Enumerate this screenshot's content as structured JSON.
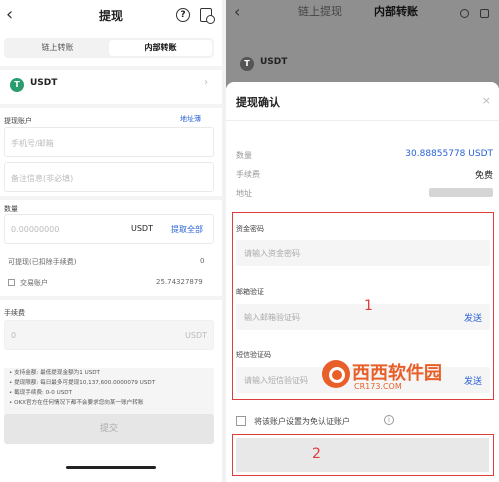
{
  "left": {
    "title": "提现",
    "help_glyph": "?",
    "tabs": [
      {
        "label": "链上转账"
      },
      {
        "label": "内部转账"
      }
    ],
    "coin": {
      "name": "USDT",
      "badge": "T"
    },
    "account": {
      "label": "提现账户",
      "link": "地址薄",
      "phone_placeholder": "手机号/邮箱",
      "remark_placeholder": "备注信息(非必填)"
    },
    "amount": {
      "label": "数量",
      "value": "0.00000000",
      "unit": "USDT",
      "max_link": "提取全部",
      "available_label": "可提现(已扣除手续费)",
      "available_value": "0",
      "trade_account_label": "交易账户",
      "trade_account_value": "25.74327879"
    },
    "fee": {
      "label": "手续费",
      "value": "0",
      "unit": "USDT"
    },
    "notes": [
      "• 支持金额: 最低提现金额为1 USDT",
      "• 提现限额: 每日最多可提现10,137,600.0000079 USDT",
      "• 截现手续费: 0-0 USDT",
      "• OKX官方在任何情况下都不会要求您向某一账户转账"
    ],
    "submit_label": "提交"
  },
  "right": {
    "bg_tabs": [
      "链上提现",
      "内部转账"
    ],
    "coin": {
      "name": "USDT",
      "badge": "T"
    },
    "sheet": {
      "title": "提现确认",
      "close_glyph": "×",
      "amount_key": "数量",
      "amount_value": "30.88855778 USDT",
      "fee_key": "手续费",
      "fee_value": "免费",
      "address_key": "地址",
      "fund_pw_label": "资金密码",
      "fund_pw_placeholder": "请输入资金密码",
      "email_label": "邮箱验证",
      "email_placeholder": "输入邮箱验证码",
      "email_send": "发送",
      "sms_label": "短信验证码",
      "sms_placeholder": "请输入短信验证码",
      "sms_send": "发送",
      "checkbox_label": "将该账户设置为免认证账户",
      "info_glyph": "i"
    },
    "annotations": {
      "mark1": "1",
      "mark2": "2"
    },
    "watermark": {
      "text": "西西软件园",
      "url": "CR173.COM"
    }
  },
  "colors": {
    "accent_blue": "#2962d6",
    "annotation_red": "#e03c3c",
    "coin_green": "#2a9d6e",
    "watermark_orange": "#e95f2a"
  }
}
